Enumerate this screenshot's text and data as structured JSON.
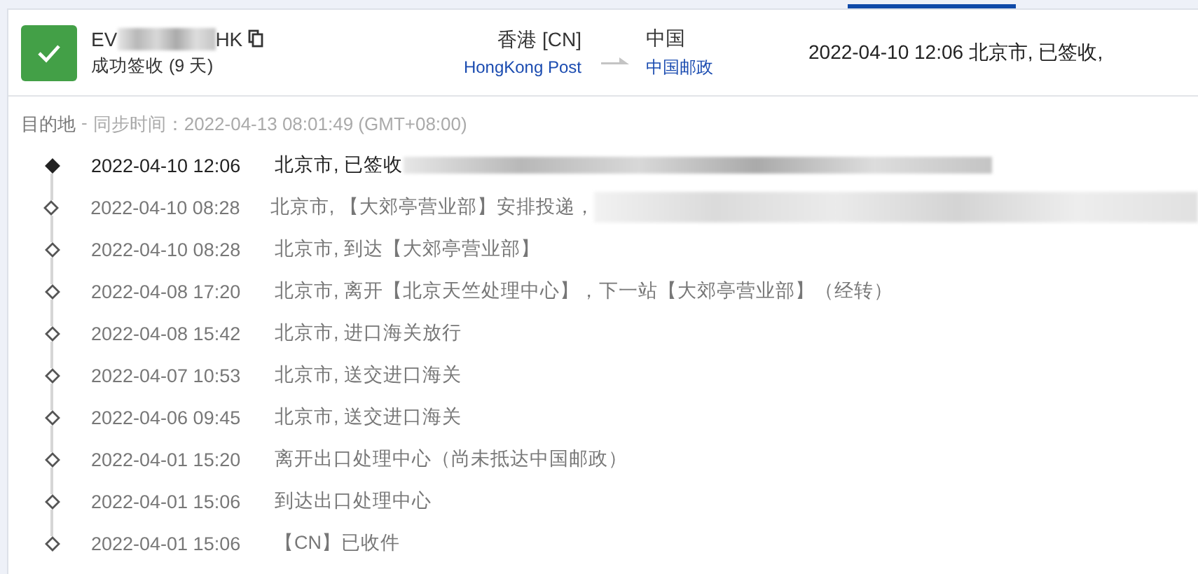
{
  "shipment": {
    "tracking_prefix": "EV",
    "tracking_suffix": "HK",
    "status": "成功签收 (9 天)",
    "delivered": true,
    "origin": {
      "place": "香港 [CN]",
      "carrier": "HongKong Post"
    },
    "destination": {
      "place": "中国",
      "carrier": "中国邮政"
    },
    "latest": "2022-04-10 12:06  北京市, 已签收,"
  },
  "sync": {
    "label": "目的地",
    "separator": "-",
    "text": "同步时间：2022-04-13 08:01:49 (GMT+08:00)"
  },
  "events": [
    {
      "time": "2022-04-10 12:06",
      "text": "北京市, 已签收",
      "current": true,
      "redacted": true
    },
    {
      "time": "2022-04-10 08:28",
      "text": "北京市, 【大郊亭营业部】安排投递，",
      "current": false,
      "redacted": true
    },
    {
      "time": "2022-04-10 08:28",
      "text": "北京市, 到达【大郊亭营业部】",
      "current": false,
      "redacted": false
    },
    {
      "time": "2022-04-08 17:20",
      "text": "北京市, 离开【北京天竺处理中心】，下一站【大郊亭营业部】（经转）",
      "current": false,
      "redacted": false
    },
    {
      "time": "2022-04-08 15:42",
      "text": "北京市, 进口海关放行",
      "current": false,
      "redacted": false
    },
    {
      "time": "2022-04-07 10:53",
      "text": "北京市, 送交进口海关",
      "current": false,
      "redacted": false
    },
    {
      "time": "2022-04-06 09:45",
      "text": "北京市, 送交进口海关",
      "current": false,
      "redacted": false
    },
    {
      "time": "2022-04-01 15:20",
      "text": "离开出口处理中心（尚未抵达中国邮政）",
      "current": false,
      "redacted": false
    },
    {
      "time": "2022-04-01 15:06",
      "text": "到达出口处理中心",
      "current": false,
      "redacted": false
    },
    {
      "time": "2022-04-01 15:06",
      "text": "【CN】已收件",
      "current": false,
      "redacted": false
    }
  ]
}
